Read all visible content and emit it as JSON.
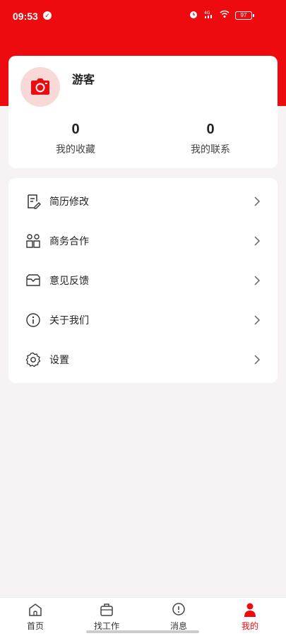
{
  "status_bar": {
    "time": "09:53",
    "battery": "97",
    "icons": [
      "check-circle-icon",
      "alarm-icon",
      "4g-signal-icon",
      "wifi-icon",
      "battery-icon"
    ]
  },
  "theme": {
    "accent": "#ee0b0f",
    "background": "#f7f3f4"
  },
  "profile": {
    "avatar_icon": "camera-icon",
    "username": "游客",
    "stats": [
      {
        "value": "0",
        "label": "我的收藏"
      },
      {
        "value": "0",
        "label": "我的联系"
      }
    ]
  },
  "menu": {
    "items": [
      {
        "label": "简历修改",
        "icon": "resume-edit-icon"
      },
      {
        "label": "商务合作",
        "icon": "partners-icon"
      },
      {
        "label": "意见反馈",
        "icon": "mail-icon"
      },
      {
        "label": "关于我们",
        "icon": "info-icon"
      },
      {
        "label": "设置",
        "icon": "gear-icon"
      }
    ]
  },
  "tabbar": {
    "tabs": [
      {
        "label": "首页",
        "icon": "home-icon",
        "active": false
      },
      {
        "label": "找工作",
        "icon": "briefcase-icon",
        "active": false
      },
      {
        "label": "消息",
        "icon": "message-icon",
        "active": false
      },
      {
        "label": "我的",
        "icon": "person-icon",
        "active": true
      }
    ]
  }
}
